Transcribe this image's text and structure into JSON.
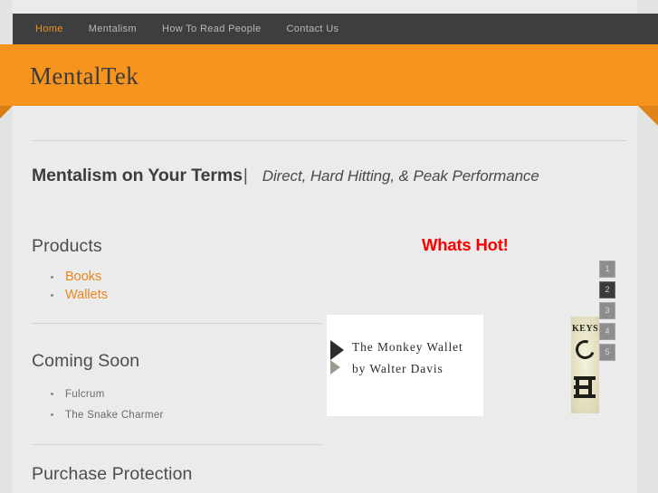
{
  "site": {
    "title": "MentalTek"
  },
  "nav": {
    "items": [
      {
        "label": "Home",
        "active": true
      },
      {
        "label": "Mentalism",
        "active": false
      },
      {
        "label": "How To Read People",
        "active": false
      },
      {
        "label": "Contact Us",
        "active": false
      }
    ]
  },
  "tagline": {
    "strong": "Mentalism on Your Terms",
    "separator": "|",
    "emphasis": "Direct, Hard Hitting, & Peak Performance"
  },
  "sections": {
    "products": {
      "heading": "Products",
      "links": [
        {
          "label": "Books"
        },
        {
          "label": "Wallets"
        }
      ]
    },
    "coming_soon": {
      "heading": "Coming Soon",
      "items": [
        {
          "label": "Fulcrum"
        },
        {
          "label": "The Snake Charmer"
        }
      ]
    },
    "purchase_protection": {
      "heading": "Purchase Protection"
    }
  },
  "whats_hot": {
    "heading": "Whats Hot!",
    "heading_color": "#fc0000",
    "slide": {
      "line1": "The Monkey Wallet",
      "line2": "by Walter Davis"
    },
    "thumbnail": {
      "caption": "KEYS"
    },
    "pager": {
      "items": [
        {
          "label": "1",
          "active": false
        },
        {
          "label": "2",
          "active": true
        },
        {
          "label": "3",
          "active": false
        },
        {
          "label": "4",
          "active": false
        },
        {
          "label": "5",
          "active": false
        }
      ]
    }
  },
  "colors": {
    "accent_orange": "#f7941e",
    "link_orange": "#e8871e",
    "nav_background": "#3e3e3e",
    "page_background": "#e2e4e1",
    "content_background": "#ebebeb",
    "hot_red": "#fc0000"
  }
}
